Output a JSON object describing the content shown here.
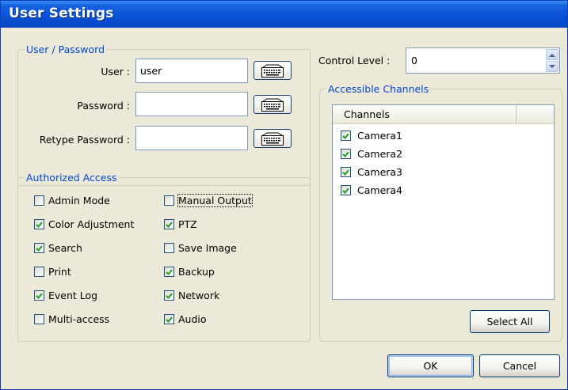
{
  "window": {
    "title": "User Settings"
  },
  "user_password": {
    "legend": "User / Password",
    "user_label": "User :",
    "user_value": "user",
    "password_label": "Password :",
    "password_value": "",
    "retype_label": "Retype Password :",
    "retype_value": ""
  },
  "authorized_access": {
    "legend": "Authorized Access",
    "items": [
      {
        "label": "Admin Mode",
        "checked": false
      },
      {
        "label": "Color Adjustment",
        "checked": true
      },
      {
        "label": "Search",
        "checked": true
      },
      {
        "label": "Print",
        "checked": false
      },
      {
        "label": "Event Log",
        "checked": true
      },
      {
        "label": "Multi-access",
        "checked": false
      },
      {
        "label": "Manual Output",
        "checked": false
      },
      {
        "label": "PTZ",
        "checked": true
      },
      {
        "label": "Save Image",
        "checked": false
      },
      {
        "label": "Backup",
        "checked": true
      },
      {
        "label": "Network",
        "checked": true
      },
      {
        "label": "Audio",
        "checked": true
      }
    ]
  },
  "control_level": {
    "label": "Control Level :",
    "value": "0"
  },
  "accessible_channels": {
    "legend": "Accessible Channels",
    "column_header": "Channels",
    "channels": [
      {
        "label": "Camera1",
        "checked": true
      },
      {
        "label": "Camera2",
        "checked": true
      },
      {
        "label": "Camera3",
        "checked": true
      },
      {
        "label": "Camera4",
        "checked": true
      }
    ],
    "select_all_label": "Select All"
  },
  "buttons": {
    "ok_label": "OK",
    "cancel_label": "Cancel"
  },
  "colors": {
    "title_bar": "#0a52d8",
    "group_legend": "#0046d5",
    "dialog_bg": "#ece9d8",
    "check_mark": "#21a121"
  },
  "icons": {
    "keyboard_button": "keyboard-icon",
    "spin_up": "chevron-up-icon",
    "spin_down": "chevron-down-icon"
  }
}
